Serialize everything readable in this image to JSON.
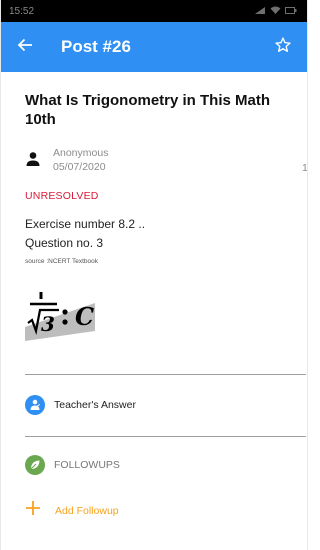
{
  "status_bar": {
    "time": "15:52"
  },
  "app_bar": {
    "title": "Post #26",
    "back_icon": "arrow-left-icon",
    "favorite_icon": "star-outline-icon",
    "color": "#2f8ff2"
  },
  "post": {
    "title": "What Is Trigonometry in This Math 10th",
    "author": "Anonymous",
    "date": "05/07/2020",
    "count": "1",
    "status": "UNRESOLVED",
    "status_color": "#d81b3a",
    "body_line1": "Exercise number 8.2 ..",
    "body_line2": "Question no. 3",
    "source": "source :NCERT Textbook"
  },
  "teacher": {
    "label": "Teacher's Answer",
    "icon": "teacher-icon",
    "color": "#2f8ff2"
  },
  "followups": {
    "label": "FOLLOWUPS",
    "icon": "leaf-icon",
    "color": "#6aa84f"
  },
  "add_followup": {
    "label": "Add Followup",
    "icon": "plus-icon",
    "color": "#f7a21d"
  }
}
